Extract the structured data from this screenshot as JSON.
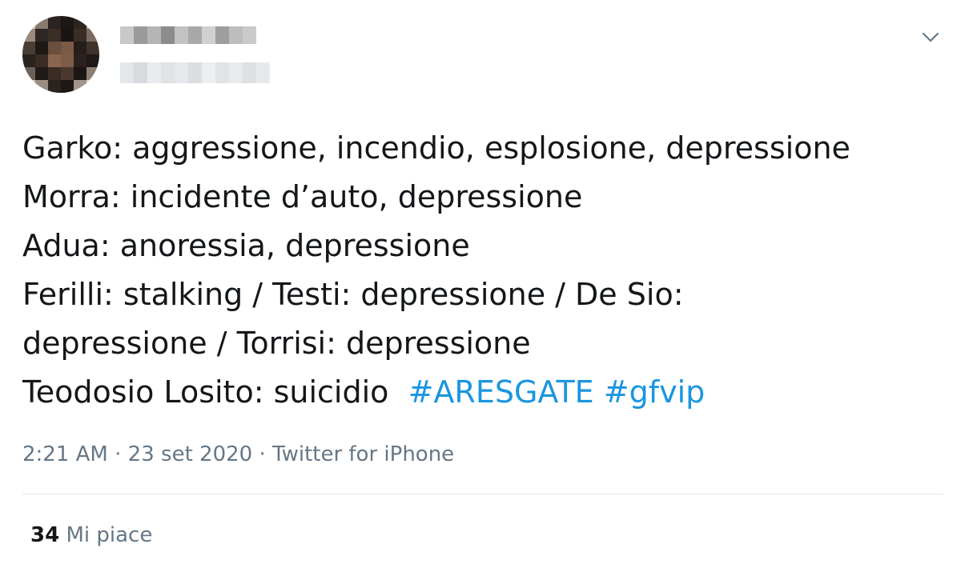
{
  "author": {
    "avatar_icon": "pixelated-avatar",
    "name": "",
    "handle": ""
  },
  "menu": {
    "icon": "chevron-down-icon"
  },
  "tweet": {
    "lines": [
      "Garko: aggressione, incendio, esplosione, depressione",
      "Morra: incidente d’auto, depressione",
      "Adua: anoressia, depressione",
      "Ferilli: stalking / Testi: depressione / De Sio:",
      "depressione / Torrisi: depressione"
    ],
    "last_line_text": "Teodosio Losito: suicidio ",
    "hashtags": [
      "#ARESGATE",
      "#gfvip"
    ]
  },
  "meta": {
    "time": "2:21 AM",
    "separator_1": " · ",
    "date": "23 set 2020",
    "separator_2": " · ",
    "source": "Twitter for iPhone"
  },
  "stats": {
    "likes_count": "34",
    "likes_label": " Mi piace"
  },
  "colors": {
    "text": "#14171a",
    "secondary": "#657786",
    "link": "#1b95e0",
    "divider": "#e1e8ed"
  }
}
